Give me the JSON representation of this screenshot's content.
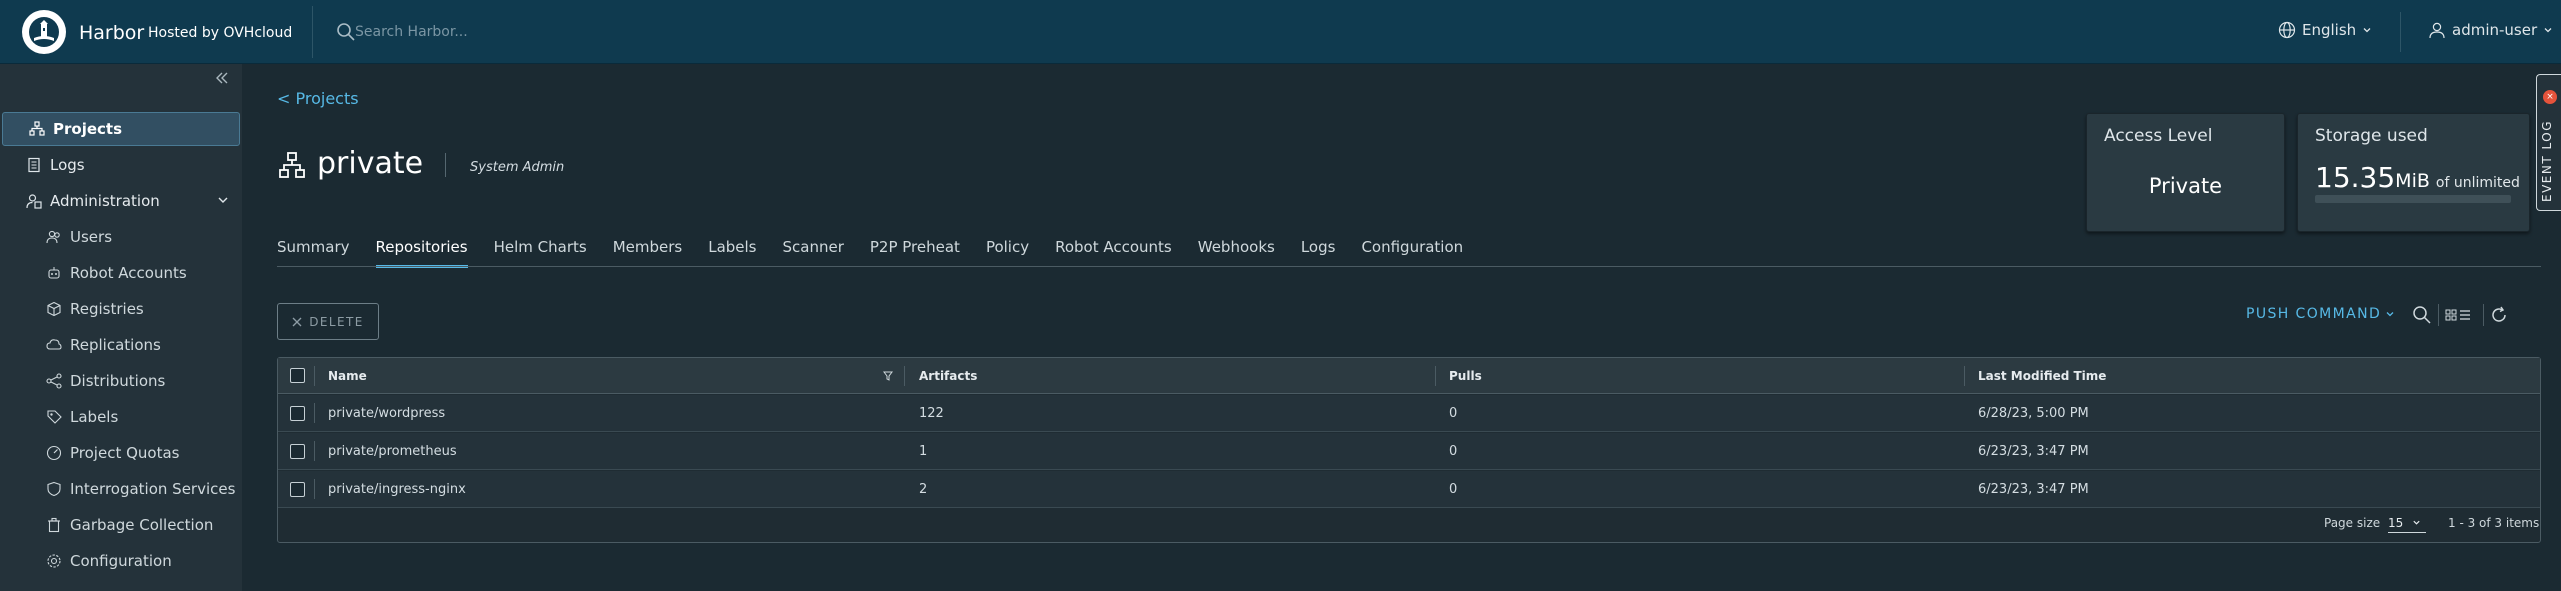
{
  "header": {
    "brand": "Harbor",
    "brand_sub": "Hosted by OVHcloud",
    "search_placeholder": "Search Harbor...",
    "language": "English",
    "user": "admin-user"
  },
  "sidebar": {
    "items": [
      {
        "label": "Projects",
        "icon": "projects-icon",
        "active": true
      },
      {
        "label": "Logs",
        "icon": "logs-icon"
      },
      {
        "label": "Administration",
        "icon": "administration-icon",
        "expanded": true
      },
      {
        "label": "Users",
        "icon": "users-icon"
      },
      {
        "label": "Robot Accounts",
        "icon": "robot-icon"
      },
      {
        "label": "Registries",
        "icon": "registries-icon"
      },
      {
        "label": "Replications",
        "icon": "replications-icon"
      },
      {
        "label": "Distributions",
        "icon": "distributions-icon"
      },
      {
        "label": "Labels",
        "icon": "labels-icon"
      },
      {
        "label": "Project Quotas",
        "icon": "quotas-icon"
      },
      {
        "label": "Interrogation Services",
        "icon": "interrogation-icon"
      },
      {
        "label": "Garbage Collection",
        "icon": "garbage-icon"
      },
      {
        "label": "Configuration",
        "icon": "configuration-icon"
      }
    ]
  },
  "breadcrumb": "< Projects",
  "project": {
    "name": "private",
    "role": "System Admin"
  },
  "access_card": {
    "title": "Access Level",
    "value": "Private"
  },
  "storage_card": {
    "title": "Storage used",
    "value": "15.35",
    "unit": "MiB",
    "limit": "of unlimited",
    "usage_fraction": 0
  },
  "event_log": "EVENT LOG",
  "tabs": [
    {
      "label": "Summary"
    },
    {
      "label": "Repositories",
      "active": true
    },
    {
      "label": "Helm Charts"
    },
    {
      "label": "Members"
    },
    {
      "label": "Labels"
    },
    {
      "label": "Scanner"
    },
    {
      "label": "P2P Preheat"
    },
    {
      "label": "Policy"
    },
    {
      "label": "Robot Accounts"
    },
    {
      "label": "Webhooks"
    },
    {
      "label": "Logs"
    },
    {
      "label": "Configuration"
    }
  ],
  "toolbar": {
    "delete_label": "DELETE",
    "push_command": "PUSH COMMAND"
  },
  "table": {
    "columns": [
      "Name",
      "Artifacts",
      "Pulls",
      "Last Modified Time"
    ],
    "rows": [
      {
        "name": "private/wordpress",
        "artifacts": "122",
        "pulls": "0",
        "modified": "6/28/23, 5:00 PM"
      },
      {
        "name": "private/prometheus",
        "artifacts": "1",
        "pulls": "0",
        "modified": "6/23/23, 3:47 PM"
      },
      {
        "name": "private/ingress-nginx",
        "artifacts": "2",
        "pulls": "0",
        "modified": "6/23/23, 3:47 PM"
      }
    ],
    "page_size_label": "Page size",
    "page_size": "15",
    "page_info": "1 - 3 of 3 items"
  },
  "colors": {
    "header_bg": "#0f3a4f",
    "sidebar_bg": "#24323a",
    "main_bg": "#1b2a32",
    "accent": "#57b9e6",
    "badge": "#e5533b"
  }
}
